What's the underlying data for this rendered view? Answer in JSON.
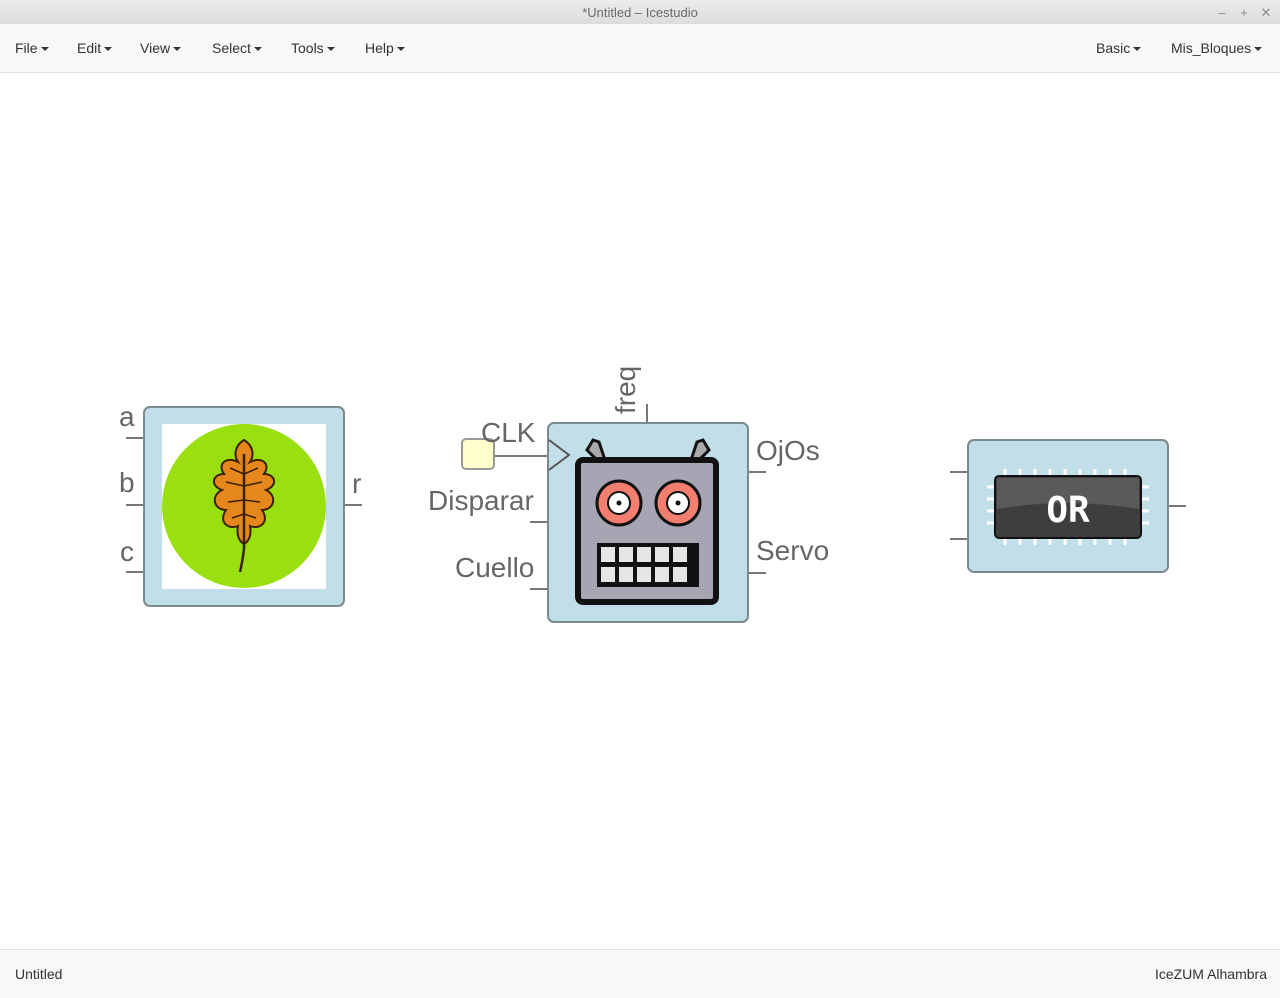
{
  "window": {
    "title": "*Untitled – Icestudio",
    "controls": [
      "–",
      "+",
      "✕"
    ]
  },
  "menubar": {
    "left": [
      "File",
      "Edit",
      "View",
      "Select",
      "Tools",
      "Help"
    ],
    "right": [
      "Basic",
      "Mis_Bloques"
    ]
  },
  "blocks": {
    "leaf_block": {
      "icon": "oak-leaf-icon",
      "inputs": [
        "a",
        "b",
        "c"
      ],
      "outputs": [
        "r"
      ],
      "colors": {
        "circle": "#9adf0f",
        "leaf": "#e5871c"
      }
    },
    "robot_block": {
      "icon": "robot-face-icon",
      "clock_input": "CLK",
      "inputs": [
        "Disparar",
        "Cuello"
      ],
      "parameter": "freq",
      "outputs": [
        "OjOs",
        "Servo"
      ],
      "colors": {
        "face": "#a7a4b4",
        "eyes": "#f27e6f"
      }
    },
    "or_block": {
      "icon": "or-gate-chip-icon",
      "label": "OR"
    }
  },
  "colors": {
    "block_fill": "#c2dfe9",
    "block_border": "#7a8a8f",
    "port_line": "#777777"
  },
  "statusbar": {
    "file": "Untitled",
    "board": "IceZUM Alhambra"
  }
}
